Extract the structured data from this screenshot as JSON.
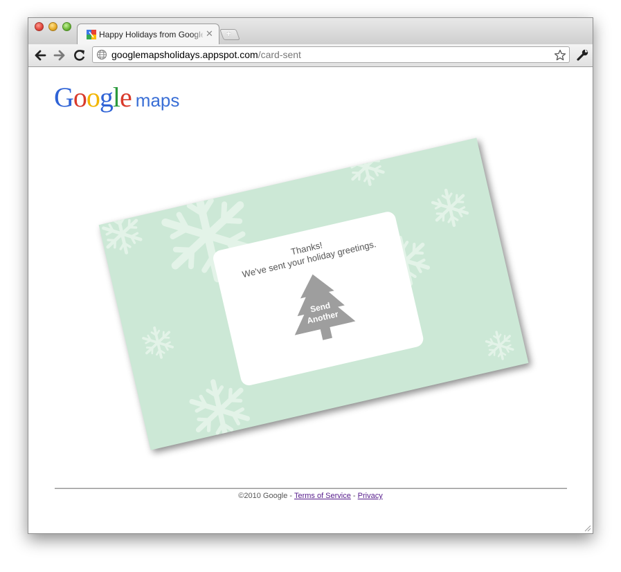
{
  "browser": {
    "tab_title": "Happy Holidays from Google Maps",
    "new_tab_glyph": "+",
    "close_glyph": "✕",
    "url_host": "googlemapsholidays.appspot.com",
    "url_path": "/card-sent",
    "icons": {
      "back": "back-arrow-icon",
      "forward": "forward-arrow-icon",
      "reload": "reload-icon",
      "star": "bookmark-star-icon",
      "wrench": "wrench-icon",
      "globe": "globe-icon"
    }
  },
  "page": {
    "logo_text": "Google",
    "logo_suffix": "maps",
    "card": {
      "thanks": "Thanks!",
      "message": "We've sent your holiday greetings.",
      "button_line1": "Send",
      "button_line2": "Another",
      "colors": {
        "card_bg": "#cce8d6",
        "tree": "#9e9e9e"
      }
    },
    "footer": {
      "copyright": "©2010 Google - ",
      "terms": "Terms of Service",
      "separator": " - ",
      "privacy": "Privacy"
    }
  }
}
